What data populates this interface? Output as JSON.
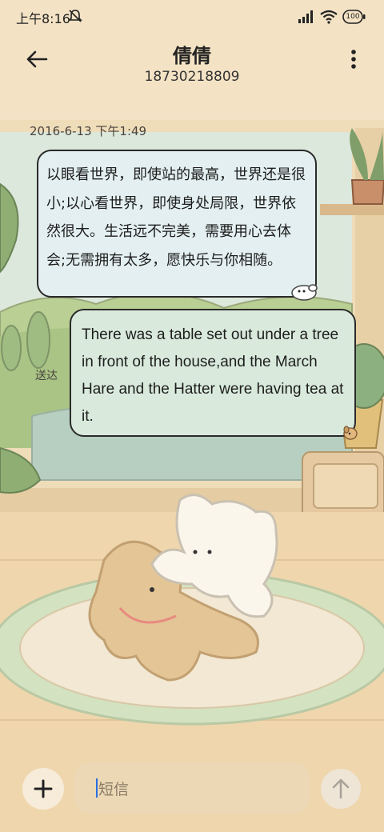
{
  "status_bar": {
    "time": "上午8:16",
    "battery": "100"
  },
  "header": {
    "contact_name": "倩倩",
    "contact_number": "18730218809"
  },
  "conversation": {
    "timestamp": "2016-6-13 下午1:49",
    "incoming_message": "以眼看世界，即使站的最高，世界还是很小;以心看世界，即使身处局限，世界依然很大。生活远不完美，需要用心去体会;无需拥有太多，愿快乐与你相随。",
    "outgoing_message": "There was a table set out under a tree in front of the house,and the March Hare and the Hatter were having tea at it.",
    "delivery_status": "送达"
  },
  "composer": {
    "placeholder": "短信"
  },
  "colors": {
    "incoming_bubble": "#e3eff0",
    "outgoing_bubble": "#d9eadc",
    "background": "#f3e2c4"
  }
}
